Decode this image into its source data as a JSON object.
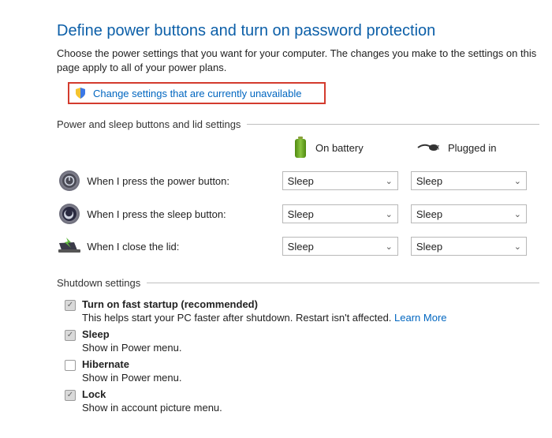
{
  "title": "Define power buttons and turn on password protection",
  "intro": "Choose the power settings that you want for your computer. The changes you make to the settings on this page apply to all of your power plans.",
  "change_link": "Change settings that are currently unavailable",
  "section_power": "Power and sleep buttons and lid settings",
  "header_battery": "On battery",
  "header_plugged": "Plugged in",
  "rows": {
    "power_button": {
      "label": "When I press the power button:",
      "battery": "Sleep",
      "plugged": "Sleep"
    },
    "sleep_button": {
      "label": "When I press the sleep button:",
      "battery": "Sleep",
      "plugged": "Sleep"
    },
    "close_lid": {
      "label": "When I close the lid:",
      "battery": "Sleep",
      "plugged": "Sleep"
    }
  },
  "section_shutdown": "Shutdown settings",
  "shutdown": {
    "fast_startup": {
      "title": "Turn on fast startup (recommended)",
      "desc": "This helps start your PC faster after shutdown. Restart isn't affected. ",
      "learn_more": "Learn More",
      "checked": true
    },
    "sleep": {
      "title": "Sleep",
      "desc": "Show in Power menu.",
      "checked": true
    },
    "hibernate": {
      "title": "Hibernate",
      "desc": "Show in Power menu.",
      "checked": false
    },
    "lock": {
      "title": "Lock",
      "desc": "Show in account picture menu.",
      "checked": true
    }
  }
}
